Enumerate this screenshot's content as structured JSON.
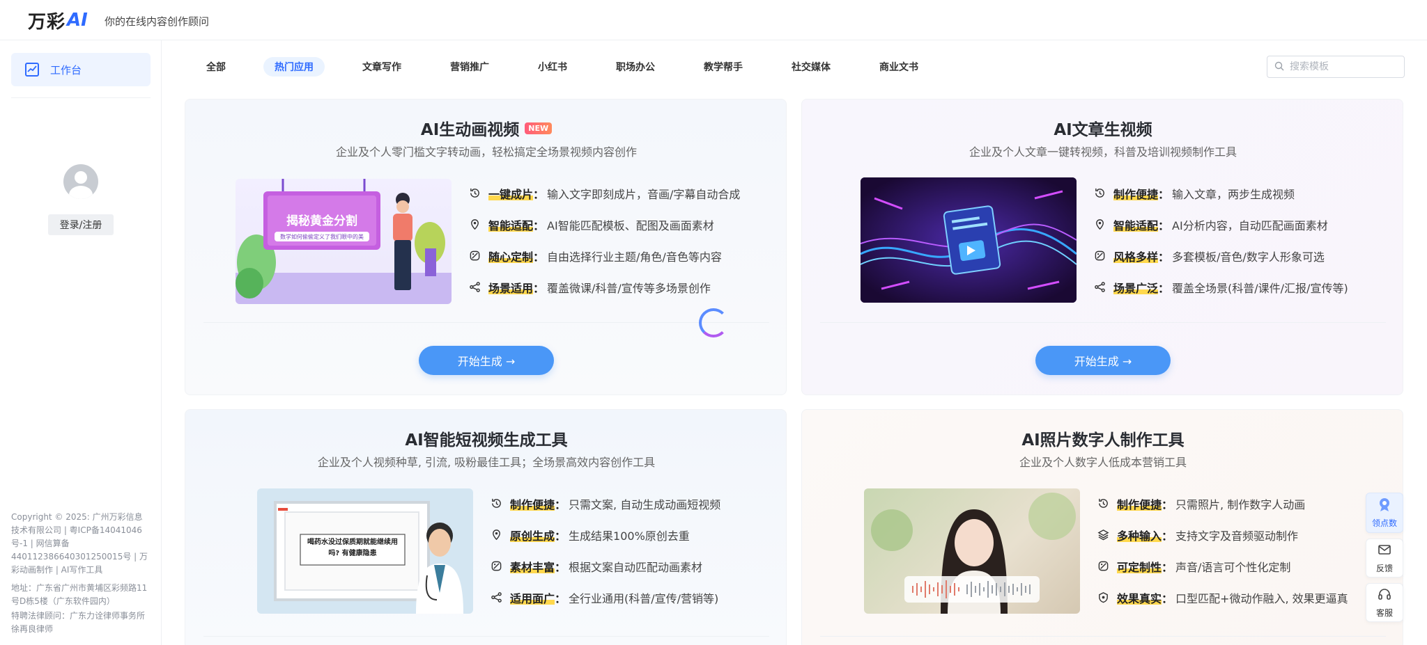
{
  "header": {
    "logo_text": "万彩",
    "logo_ai": "AI",
    "slogan": "你的在线内容创作顾问"
  },
  "sidebar": {
    "workbench_label": "工作台",
    "login_label": "登录/注册",
    "footer_copyright": "Copyright © 2025: 广州万彩信息技术有限公司 | 粤ICP备14041046号-1 | 网信算备440112386640301250015号 | 万彩动画制作 | AI写作工具",
    "footer_address": "地址：广东省广州市黄埔区彩频路11号D栋5楼（广东软件园内）",
    "footer_legal": "特聘法律顾问：广东力诠律师事务所徐再良律师"
  },
  "tabs": [
    {
      "label": "全部"
    },
    {
      "label": "热门应用"
    },
    {
      "label": "文章写作"
    },
    {
      "label": "营销推广"
    },
    {
      "label": "小红书"
    },
    {
      "label": "职场办公"
    },
    {
      "label": "教学帮手"
    },
    {
      "label": "社交媒体"
    },
    {
      "label": "商业文书"
    }
  ],
  "active_tab": "热门应用",
  "search": {
    "placeholder": "搜索模板"
  },
  "cards": [
    {
      "title": "AI生动画视频",
      "badge": "NEW",
      "subtitle": "企业及个人零门槛文字转动画，轻松搞定全场景视频内容创作",
      "thumb_title": "揭秘黄金分割",
      "thumb_sub": "数学如何偷偷定义了我们眼中的美",
      "features": [
        {
          "icon": "refresh-clock-icon",
          "key": "一键成片",
          "text": "输入文字即刻成片，音画/字幕自动合成"
        },
        {
          "icon": "location-pin-icon",
          "key": "智能适配",
          "text": "AI智能匹配模板、配图及画面素材"
        },
        {
          "icon": "custom-tag-icon",
          "key": "随心定制",
          "text": "自由选择行业主题/角色/音色等内容"
        },
        {
          "icon": "share-icon",
          "key": "场景适用",
          "text": "覆盖微课/科普/宣传等多场景创作"
        }
      ],
      "button": "开始生成 →"
    },
    {
      "title": "AI文章生视频",
      "subtitle": "企业及个人文章一键转视频，科普及培训视频制作工具",
      "features": [
        {
          "icon": "refresh-clock-icon",
          "key": "制作便捷",
          "text": "输入文章，两步生成视频"
        },
        {
          "icon": "location-pin-icon",
          "key": "智能适配",
          "text": "AI分析内容，自动匹配画面素材"
        },
        {
          "icon": "custom-tag-icon",
          "key": "风格多样",
          "text": "多套模板/音色/数字人形象可选"
        },
        {
          "icon": "share-icon",
          "key": "场景广泛",
          "text": "覆盖全场景(科普/课件/汇报/宣传等)"
        }
      ],
      "button": "开始生成 →"
    },
    {
      "title": "AI智能短视频生成工具",
      "subtitle": "企业及个人视频种草, 引流, 吸粉最佳工具；全场景高效内容创作工具",
      "thumb_text": "喝药水没过保质期就能继续用吗? 有健康隐患",
      "features": [
        {
          "icon": "refresh-clock-icon",
          "key": "制作便捷",
          "text": "只需文案, 自动生成动画短视频"
        },
        {
          "icon": "location-pin-icon",
          "key": "原创生成",
          "text": "生成结果100%原创去重"
        },
        {
          "icon": "custom-tag-icon",
          "key": "素材丰富",
          "text": "根据文案自动匹配动画素材"
        },
        {
          "icon": "share-icon",
          "key": "适用面广",
          "text": "全行业通用(科普/宣传/营销等)"
        }
      ]
    },
    {
      "title": "AI照片数字人制作工具",
      "subtitle": "企业及个人数字人低成本营销工具",
      "features": [
        {
          "icon": "refresh-clock-icon",
          "key": "制作便捷",
          "text": "只需照片, 制作数字人动画"
        },
        {
          "icon": "layers-icon",
          "key": "多种输入",
          "text": "支持文字及音频驱动制作"
        },
        {
          "icon": "custom-tag-icon",
          "key": "可定制性",
          "text": "声音/语言可个性化定制"
        },
        {
          "icon": "badge-check-icon",
          "key": "效果真实",
          "text": "口型匹配+微动作融入, 效果更逼真"
        }
      ]
    }
  ],
  "float_tools": [
    {
      "label": "领点数",
      "icon": "gift-icon"
    },
    {
      "label": "反馈",
      "icon": "mail-icon"
    },
    {
      "label": "客服",
      "icon": "headset-icon"
    }
  ],
  "colors": {
    "primary": "#2f6bff",
    "button": "#4a97f7",
    "highlight": "#ffd84d",
    "badge": "#ff5c7a"
  }
}
